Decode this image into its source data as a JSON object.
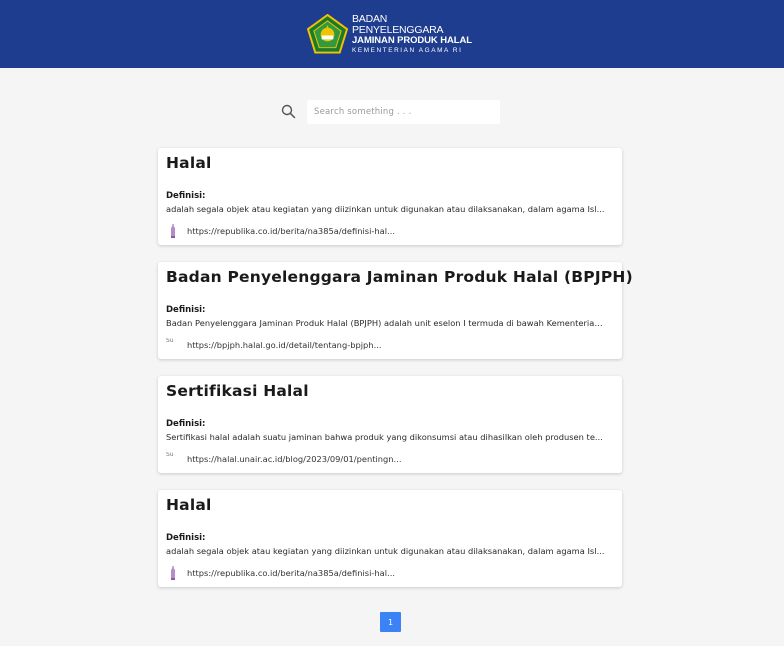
{
  "header": {
    "logo_line1": "BADAN PENYELENGGARA",
    "logo_line2": "JAMINAN PRODUK HALAL",
    "logo_line3": "KEMENTERIAN AGAMA RI",
    "background_color": "#1f3d8f"
  },
  "search": {
    "icon": "search-icon",
    "placeholder": "Search something . . .",
    "value": ""
  },
  "results": [
    {
      "title": "Halal",
      "label": "Definisi:",
      "definition": "adalah segala objek atau kegiatan yang diizinkan untuk digunakan atau dilaksanakan, dalam agama Isl...",
      "url": "https://republika.co.id/berita/na385a/definisi-hal...",
      "favicon": "republika-favicon"
    },
    {
      "title": "Badan Penyelenggara Jaminan Produk Halal (BPJPH)",
      "label": "Definisi:",
      "definition": "Badan Penyelenggara Jaminan Produk Halal (BPJPH) adalah unit eselon I termuda di bawah Kementerian ...",
      "url": "https://bpjph.halal.go.id/detail/tentang-bpjph...",
      "favicon": "broken-image-icon",
      "favicon_alt": "Su"
    },
    {
      "title": "Sertifikasi Halal",
      "label": "Definisi:",
      "definition": "Sertifikasi halal adalah suatu jaminan bahwa produk yang dikonsumsi atau dihasilkan oleh produsen te...",
      "url": "https://halal.unair.ac.id/blog/2023/09/01/pentingn...",
      "favicon": "broken-image-icon",
      "favicon_alt": "Su"
    },
    {
      "title": "Halal",
      "label": "Definisi:",
      "definition": "adalah segala objek atau kegiatan yang diizinkan untuk digunakan atau dilaksanakan, dalam agama Isl...",
      "url": "https://republika.co.id/berita/na385a/definisi-hal...",
      "favicon": "republika-favicon"
    }
  ],
  "pagination": {
    "current": "1",
    "active_color": "#3b82f6"
  }
}
